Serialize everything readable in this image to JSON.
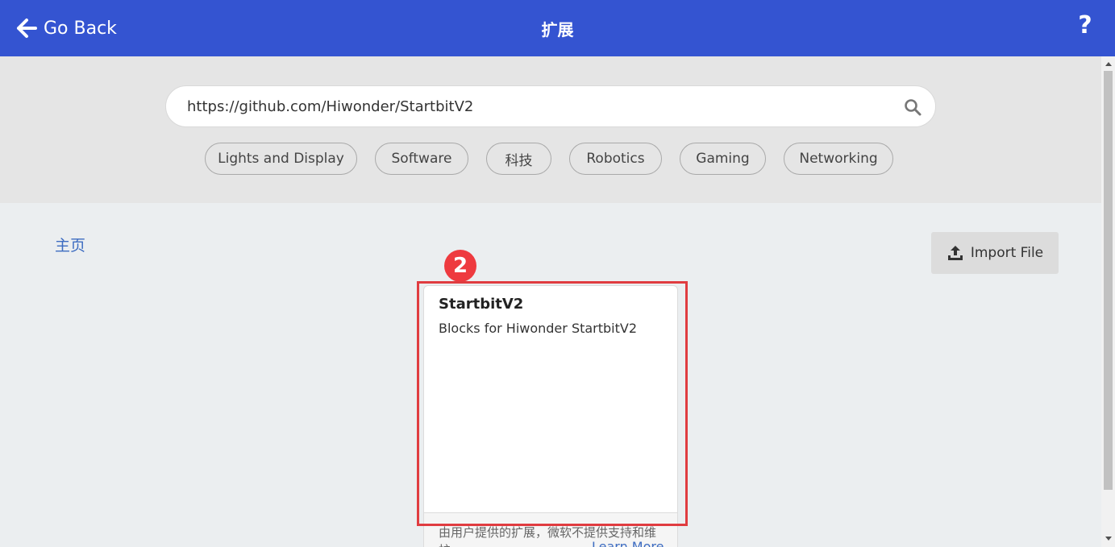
{
  "header": {
    "back_label": "Go Back",
    "title": "扩展",
    "help_label": "?",
    "colors": {
      "background": "#3454d1",
      "text": "#ffffff"
    }
  },
  "search": {
    "value": "https://github.com/Hiwonder/StartbitV2",
    "icon": "search-icon"
  },
  "tags": [
    "Lights and Display",
    "Software",
    "科技",
    "Robotics",
    "Gaming",
    "Networking"
  ],
  "breadcrumb": "主页",
  "import": {
    "label": "Import File",
    "icon": "upload-icon"
  },
  "marker": "2",
  "extension_card": {
    "title": "StartbitV2",
    "description": "Blocks for Hiwonder StartbitV2",
    "note": "由用户提供的扩展，微软不提供支持和维护。",
    "learn_more": "Learn More"
  },
  "colors": {
    "accent": "#3454d1",
    "highlight": "#e03c40",
    "link": "#3d6cc1"
  }
}
